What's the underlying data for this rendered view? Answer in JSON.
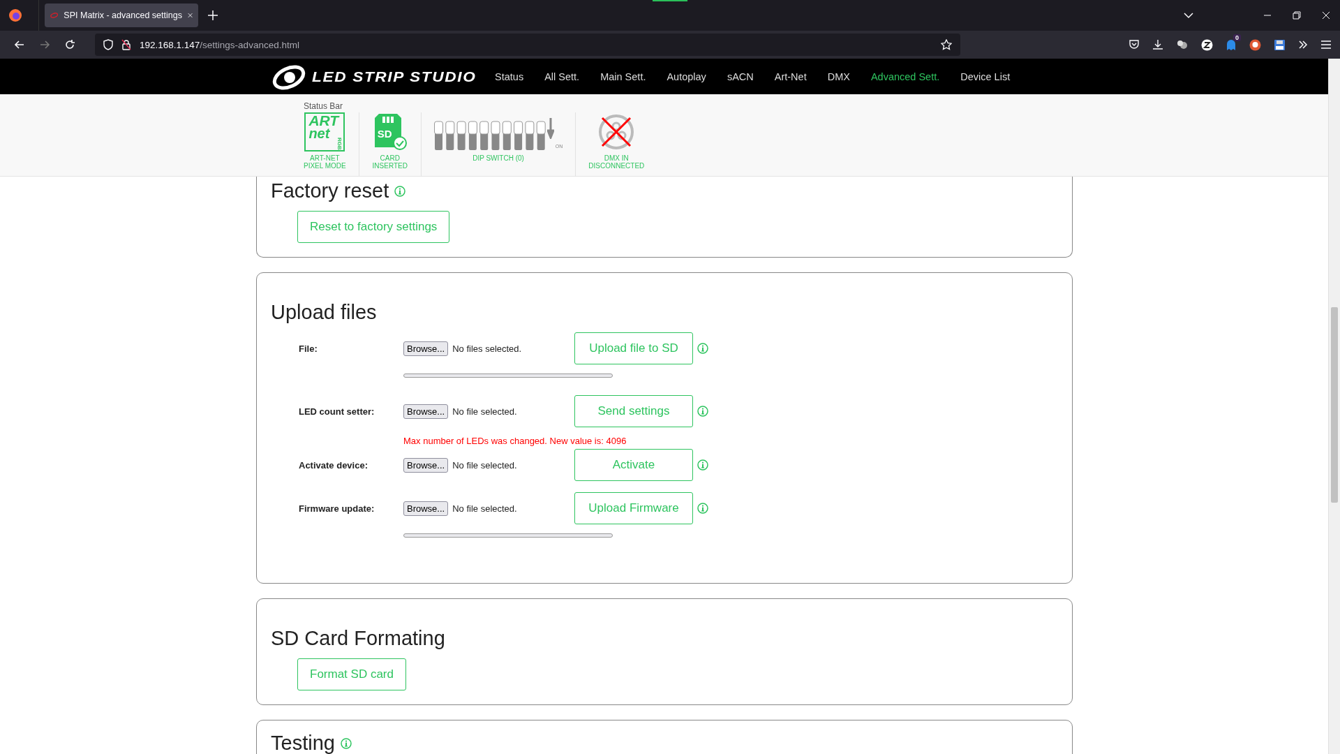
{
  "browser": {
    "tab": {
      "title": "SPI Matrix - advanced settings",
      "selected": true
    },
    "url": {
      "host": "192.168.1.147",
      "path": "/settings-advanced.html"
    },
    "extension_badge": "0"
  },
  "nav": {
    "logo": "LED STRIP STUDIO",
    "items": [
      {
        "label": "Status",
        "selected": false
      },
      {
        "label": "All Sett.",
        "selected": false
      },
      {
        "label": "Main Sett.",
        "selected": false
      },
      {
        "label": "Autoplay",
        "selected": false
      },
      {
        "label": "sACN",
        "selected": false
      },
      {
        "label": "Art-Net",
        "selected": false
      },
      {
        "label": "DMX",
        "selected": false
      },
      {
        "label": "Advanced Sett.",
        "selected": true
      },
      {
        "label": "Device List",
        "selected": false
      }
    ]
  },
  "status_bar": {
    "title": "Status Bar",
    "items": [
      {
        "kind": "artnet",
        "icon_text": "ART",
        "icon_text_2": "net",
        "icon_badge": "RGB",
        "caption": [
          "ART-NET",
          "PIXEL MODE"
        ]
      },
      {
        "kind": "sd",
        "icon_text": "SD",
        "inserted": true,
        "caption": [
          "CARD",
          "INSERTED"
        ]
      },
      {
        "kind": "dip",
        "on_label": "ON",
        "switches": [
          {
            "on": false
          },
          {
            "on": false
          },
          {
            "on": false
          },
          {
            "on": false
          },
          {
            "on": false
          },
          {
            "on": false
          },
          {
            "on": false
          },
          {
            "on": false
          },
          {
            "on": false
          },
          {
            "on": false
          }
        ],
        "caption": [
          "DIP SWITCH (0)"
        ]
      },
      {
        "kind": "dmx",
        "connected": false,
        "caption": [
          "DMX IN",
          "DISCONNECTED"
        ]
      }
    ]
  },
  "sections": [
    {
      "kind": "buttons",
      "title": "Factory reset",
      "info": true,
      "buttons": [
        "Reset to factory settings"
      ]
    },
    {
      "kind": "uploads",
      "title": "Upload files",
      "info": false,
      "rows": [
        {
          "label": "File:",
          "browse": "Browse...",
          "file_status": "No files selected.",
          "action": "Upload file to SD",
          "progress": {
            "level": 0
          }
        },
        {
          "label": "LED count setter:",
          "browse": "Browse...",
          "file_status": "No file selected.",
          "action": "Send settings",
          "message": "Max number of LEDs was changed. New value is: 4096"
        },
        {
          "label": "Activate device:",
          "browse": "Browse...",
          "file_status": "No file selected.",
          "action": "Activate"
        },
        {
          "label": "Firmware update:",
          "browse": "Browse...",
          "file_status": "No file selected.",
          "action": "Upload Firmware",
          "progress": {
            "level": 0
          }
        }
      ]
    },
    {
      "kind": "buttons",
      "title": "SD Card Formating",
      "info": false,
      "buttons": [
        "Format SD card"
      ]
    },
    {
      "kind": "buttons",
      "title": "Testing",
      "info": true
    }
  ]
}
